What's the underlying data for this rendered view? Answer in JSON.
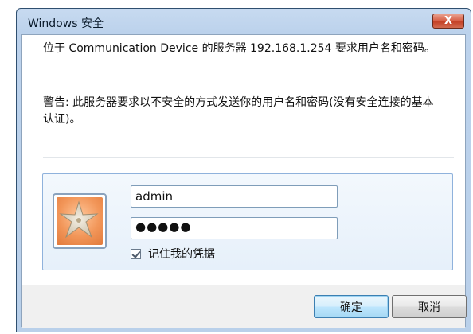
{
  "window": {
    "title": "Windows 安全",
    "close_label": "X"
  },
  "message": {
    "line1": "位于 Communication Device 的服务器 192.168.1.254 要求用户名和密码。",
    "warning": "警告: 此服务器要求以不安全的方式发送你的用户名和密码(没有安全连接的基本认证)。"
  },
  "credentials": {
    "username_value": "admin",
    "password_mask": "●●●●●",
    "remember_label": "记住我的凭据",
    "remember_checked": true
  },
  "buttons": {
    "ok": "确定",
    "cancel": "取消"
  },
  "colors": {
    "titlebar": "#bcd2ec",
    "close_red": "#c44126",
    "panel_border": "#8fb2dc",
    "avatar_orange": "#f29659"
  },
  "icons": {
    "avatar": "starfish-avatar-icon",
    "close": "close-icon",
    "check": "checkmark-icon"
  }
}
